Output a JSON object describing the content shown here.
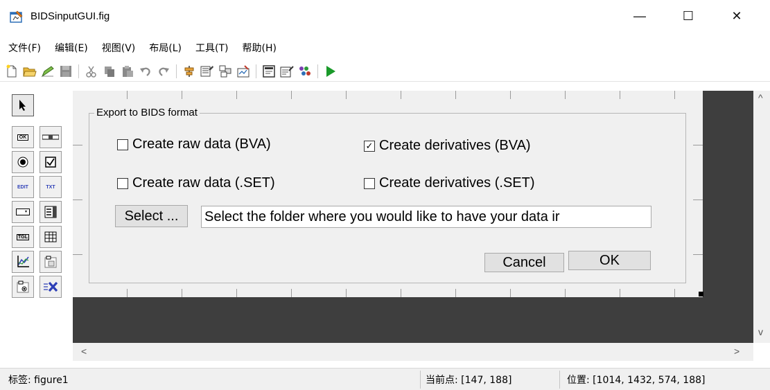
{
  "window": {
    "title": "BIDSinputGUI.fig",
    "minimize_glyph": "—",
    "maximize_glyph": "☐",
    "close_glyph": "✕"
  },
  "menu": [
    {
      "id": "file",
      "label": "文件(F)"
    },
    {
      "id": "edit",
      "label": "编辑(E)"
    },
    {
      "id": "view",
      "label": "视图(V)"
    },
    {
      "id": "layout",
      "label": "布局(L)"
    },
    {
      "id": "tools",
      "label": "工具(T)"
    },
    {
      "id": "help",
      "label": "帮助(H)"
    }
  ],
  "toolbar": {
    "icons": [
      "new-file-icon",
      "open-folder-icon",
      "edit-icon",
      "save-icon",
      "cut-icon",
      "copy-icon",
      "paste-icon",
      "undo-icon",
      "redo-icon",
      "align-icon",
      "property-inspector-icon",
      "tab-order-icon",
      "menu-editor-icon",
      "object-browser-icon",
      "editor-icon",
      "toolbar-editor-icon",
      "run-icon"
    ],
    "colors": {
      "run": "#1a9a2a"
    }
  },
  "palette": {
    "items": [
      {
        "id": "select",
        "icon": "arrow-pointer-icon",
        "label": ""
      },
      {
        "id": "pushbutton",
        "icon": "push-button-icon",
        "label": "OK"
      },
      {
        "id": "slider",
        "icon": "slider-icon",
        "label": ""
      },
      {
        "id": "radiobutton",
        "icon": "radio-button-icon",
        "label": ""
      },
      {
        "id": "checkbox",
        "icon": "checkbox-icon",
        "label": ""
      },
      {
        "id": "edittext",
        "icon": "edit-text-icon",
        "label": "EDIT"
      },
      {
        "id": "statictext",
        "icon": "static-text-icon",
        "label": "TXT"
      },
      {
        "id": "popupmenu",
        "icon": "popup-menu-icon",
        "label": ""
      },
      {
        "id": "listbox",
        "icon": "listbox-icon",
        "label": ""
      },
      {
        "id": "togglebutton",
        "icon": "toggle-button-icon",
        "label": "TGL"
      },
      {
        "id": "table",
        "icon": "table-icon",
        "label": ""
      },
      {
        "id": "axes",
        "icon": "axes-icon",
        "label": ""
      },
      {
        "id": "panel",
        "icon": "panel-icon",
        "label": ""
      },
      {
        "id": "buttongroup",
        "icon": "button-group-icon",
        "label": ""
      },
      {
        "id": "activex",
        "icon": "activex-icon",
        "label": ""
      }
    ]
  },
  "figure": {
    "panel_title": "Export to BIDS format",
    "checkboxes": [
      {
        "id": "raw_bva",
        "label": "Create raw data (BVA)",
        "checked": false
      },
      {
        "id": "deriv_bva",
        "label": "Create derivatives (BVA)",
        "checked": true
      },
      {
        "id": "raw_set",
        "label": "Create raw data (.SET)",
        "checked": false
      },
      {
        "id": "deriv_set",
        "label": "Create derivatives (.SET)",
        "checked": false
      }
    ],
    "check_glyph_on": "✓",
    "check_glyph_off": "",
    "select_button": "Select ...",
    "path_input_value": "Select the folder where you would like to have your data ir",
    "cancel_button": "Cancel",
    "ok_button": "OK"
  },
  "scroll": {
    "up": "^",
    "down": "v",
    "left": "<",
    "right": ">"
  },
  "status": {
    "tag": "标签: figure1",
    "current_point": "当前点:  [147, 188]",
    "position": "位置: [1014, 1432, 574, 188]"
  }
}
